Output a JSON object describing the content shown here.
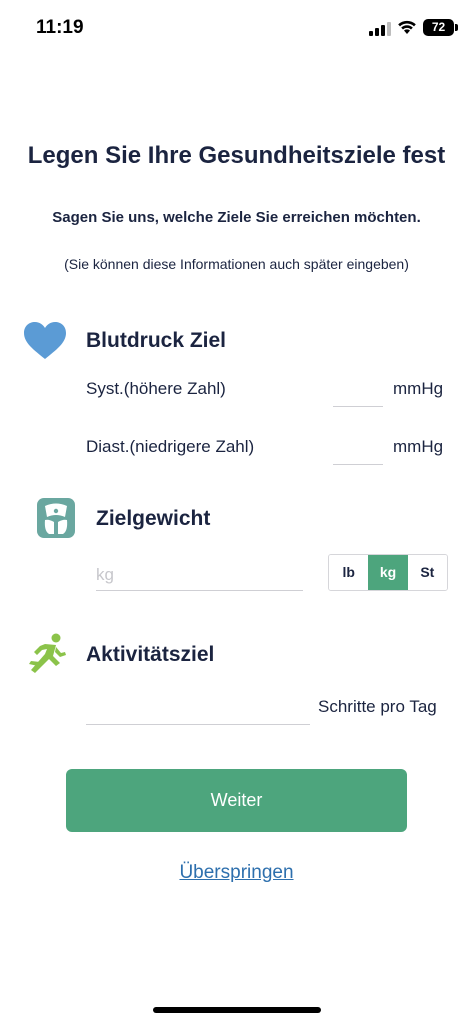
{
  "status_bar": {
    "time": "11:19",
    "battery_level": "72"
  },
  "header": {
    "title": "Legen Sie Ihre Gesundheitsziele fest",
    "subtitle": "Sagen Sie uns, welche Ziele Sie erreichen möchten.",
    "note": "(Sie können diese Informationen auch später eingeben)"
  },
  "blood_pressure": {
    "icon": "heart-icon",
    "title": "Blutdruck Ziel",
    "systolic_label": "Syst.(höhere Zahl)",
    "systolic_value": "",
    "systolic_unit": "mmHg",
    "diastolic_label": "Diast.(niedrigere Zahl)",
    "diastolic_value": "",
    "diastolic_unit": "mmHg"
  },
  "weight": {
    "icon": "scale-icon",
    "title": "Zielgewicht",
    "placeholder": "kg",
    "value": "",
    "units": [
      "lb",
      "kg",
      "St"
    ],
    "selected_unit": "kg"
  },
  "activity": {
    "icon": "running-icon",
    "title": "Aktivitätsziel",
    "value": "",
    "unit": "Schritte pro Tag"
  },
  "actions": {
    "continue_label": "Weiter",
    "skip_label": "Überspringen"
  },
  "colors": {
    "accent": "#4da57d",
    "heart": "#5b9bd5",
    "scale": "#6aa7a0",
    "runner": "#8bc34a",
    "link": "#2d6fad",
    "text": "#1b2440"
  }
}
